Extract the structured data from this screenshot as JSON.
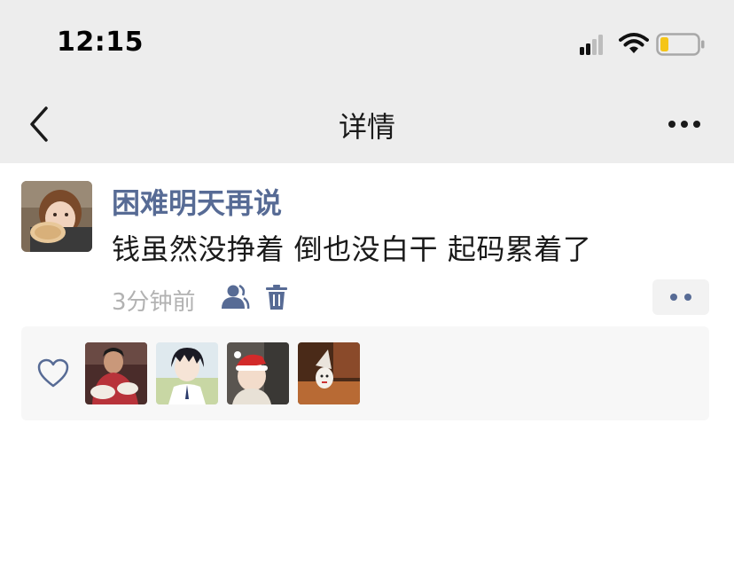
{
  "status_bar": {
    "time": "12:15",
    "icons": [
      "signal-icon",
      "wifi-icon",
      "battery-icon"
    ],
    "battery_level": 0.2,
    "battery_color": "#f5c518"
  },
  "nav": {
    "title": "详情",
    "back_icon": "chevron-left-icon",
    "more_icon": "more-horizontal-icon"
  },
  "post": {
    "username": "困难明天再说",
    "content": "钱虽然没挣着 倒也没白干 起码累着了",
    "timestamp": "3分钟前",
    "icons": [
      "visibility-icon",
      "trash-icon",
      "comment-like-menu-icon"
    ]
  },
  "likes": {
    "icon": "heart-icon",
    "count": 4
  },
  "colors": {
    "link": "#576b95",
    "text": "#1a1a1a",
    "meta": "#b2b2b2",
    "nav_bg": "#ededed",
    "likes_bg": "#f7f7f7"
  }
}
